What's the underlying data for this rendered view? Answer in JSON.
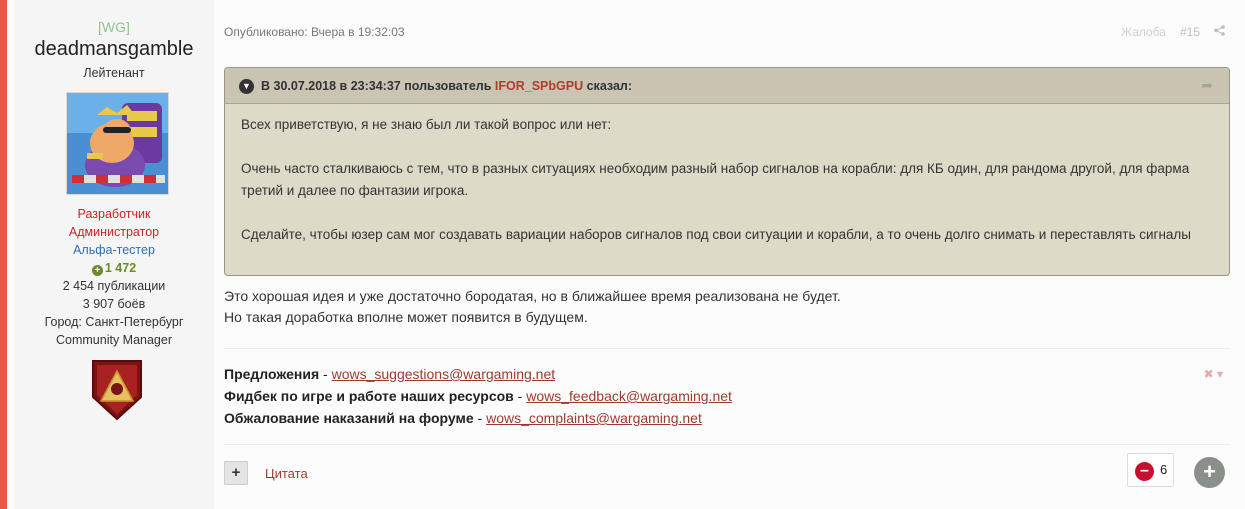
{
  "author": {
    "clan": "[WG]",
    "username": "deadmansgamble",
    "rank": "Лейтенант",
    "roles": [
      "Разработчик",
      "Администратор",
      "Альфа-тестер"
    ],
    "reputation": "1 472",
    "posts": "2 454 публикации",
    "battles": "3 907 боёв",
    "city": "Город: Санкт-Петербург",
    "title": "Community Manager",
    "colors": {
      "accent": "#ec5548",
      "reputation": "#6a8b2a"
    }
  },
  "post": {
    "published": "Опубликовано: Вчера в 19:32:03",
    "report_label": "Жалоба",
    "number": "#15"
  },
  "quote": {
    "header_prefix": "В 30.07.2018 в 23:34:37 пользователь",
    "header_user": "IFOR_SPbGPU",
    "header_suffix": "сказал:",
    "paragraphs": [
      "Всех приветствую, я не знаю был ли такой вопрос или нет:",
      "Очень часто сталкиваюсь с тем, что в разных ситуациях необходим разный набор сигналов на корабли: для КБ один, для рандома другой, для фарма третий и далее по фантазии игрока.",
      "Сделайте, чтобы юзер сам мог создавать вариации наборов сигналов под свои ситуации и корабли, а то очень долго снимать и переставлять сигналы"
    ]
  },
  "answer": {
    "lines": [
      "Это хорошая идея и уже достаточно бородатая, но в ближайшее время реализована не будет.",
      "Но такая доработка вполне может появится в будущем."
    ]
  },
  "signature": {
    "items": [
      {
        "label": "Предложения",
        "sep": " - ",
        "email": "wows_suggestions@wargaming.net"
      },
      {
        "label": "Фидбек по игре и работе наших ресурсов",
        "sep": " - ",
        "email": "wows_feedback@wargaming.net"
      },
      {
        "label": "Обжалование наказаний на форуме",
        "sep": " - ",
        "email": "wows_complaints@wargaming.net"
      }
    ]
  },
  "controls": {
    "multiquote_label": "+",
    "quote_label": "Цитата",
    "reaction_count": "6"
  }
}
